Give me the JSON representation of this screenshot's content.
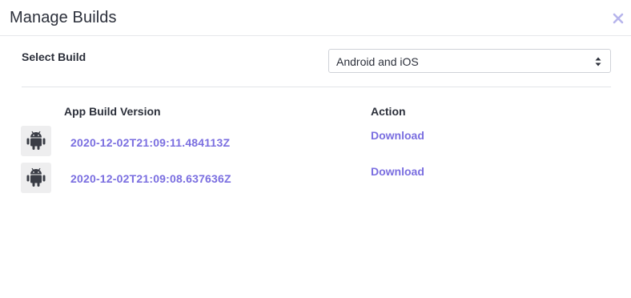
{
  "modal": {
    "title": "Manage Builds",
    "close_icon": "close-icon",
    "accent_color": "#7a6ee0"
  },
  "select_build": {
    "label": "Select Build",
    "selected_value": "Android and iOS"
  },
  "table": {
    "headers": {
      "version": "App Build Version",
      "action": "Action"
    },
    "rows": [
      {
        "platform_icon": "android-icon",
        "version": "2020-12-02T21:09:11.484113Z",
        "action": "Download"
      },
      {
        "platform_icon": "android-icon",
        "version": "2020-12-02T21:09:08.637636Z",
        "action": "Download"
      }
    ]
  }
}
